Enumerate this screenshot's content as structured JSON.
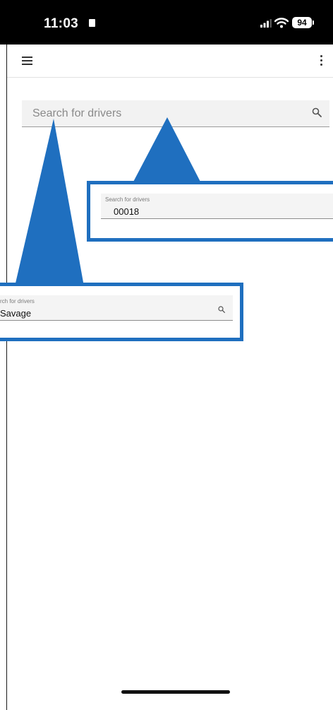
{
  "status_bar": {
    "time": "11:03",
    "battery": "94",
    "icons": [
      "lock-icon",
      "signal-icon",
      "wifi-icon",
      "battery-icon"
    ]
  },
  "app_bar": {
    "icons": [
      "hamburger-menu-icon",
      "more-vert-icon"
    ]
  },
  "search": {
    "placeholder": "Search for drivers",
    "icon": "search-icon"
  },
  "callouts": [
    {
      "label": "Search for drivers",
      "value": "00018"
    },
    {
      "label": "rch for drivers",
      "value": "Savage",
      "icon": "search-icon"
    }
  ],
  "colors": {
    "callout_blue": "#1f6fbf",
    "status_bar": "#000000",
    "field_bg": "#f2f2f2"
  }
}
